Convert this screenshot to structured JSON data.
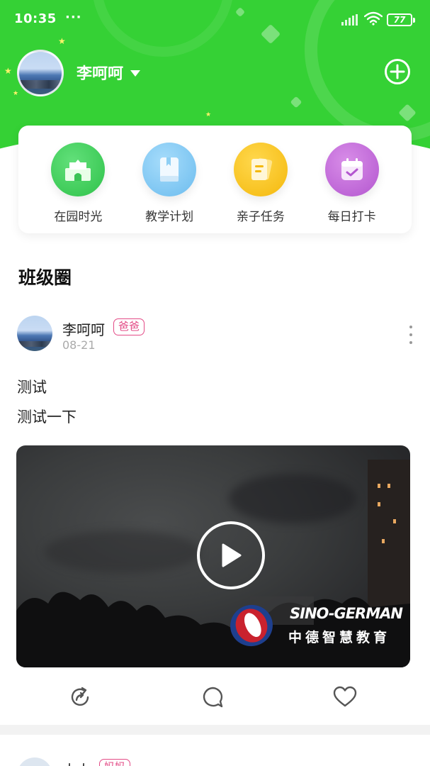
{
  "status_bar": {
    "time": "10:35",
    "dots": "···",
    "battery": "77"
  },
  "header": {
    "user_name": "李呵呵"
  },
  "quick_menu": [
    {
      "label": "在园时光",
      "icon": "school-icon",
      "color": "#3fcf5a"
    },
    {
      "label": "教学计划",
      "icon": "book-icon",
      "color": "#7cc6f2"
    },
    {
      "label": "亲子任务",
      "icon": "task-card-icon",
      "color": "#f8c21a"
    },
    {
      "label": "每日打卡",
      "icon": "calendar-check-icon",
      "color": "#c069d8"
    }
  ],
  "section": {
    "title": "班级圈"
  },
  "post": {
    "author": "李呵呵",
    "role": "爸爸",
    "date": "08-21",
    "text_line1": "测试",
    "text_line2": "测试一下",
    "video": {
      "watermark_en": "SINO-GERMAN",
      "watermark_cn": "中德智慧教育"
    }
  },
  "next_post": {
    "author": "大大",
    "role": "妈妈"
  },
  "colors": {
    "brand_green": "#35d135",
    "badge_pink": "#e34b86"
  }
}
